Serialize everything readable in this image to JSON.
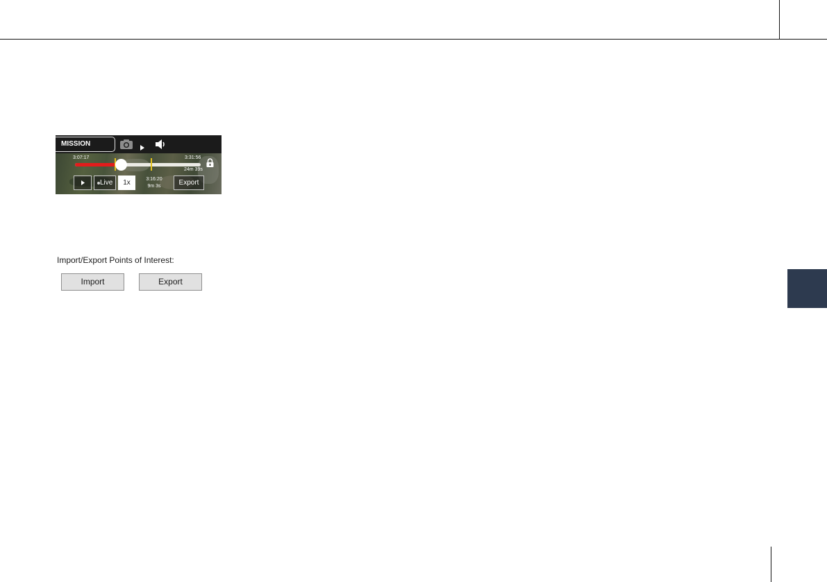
{
  "player": {
    "mission_label": "MISSION",
    "start_time": "3:07:17",
    "end_time": "3:31:56",
    "total_duration": "24m 39s",
    "live_label": "Live",
    "speed_label": "1x",
    "current_time": "3:16:20",
    "elapsed_duration": "9m 3s",
    "export_label": "Export",
    "progress": 0.37,
    "colors": {
      "played": "#e31c1c",
      "marker": "#e6c21b",
      "track": "#ecebe6"
    },
    "icons": [
      "camera-icon",
      "play-arrow-icon",
      "speaker-icon",
      "lock-icon",
      "play-icon"
    ]
  },
  "poi": {
    "label": "Import/Export Points of Interest:",
    "import_label": "Import",
    "export_label": "Export"
  },
  "page": {
    "side_tab_color": "#2d3a4f"
  }
}
